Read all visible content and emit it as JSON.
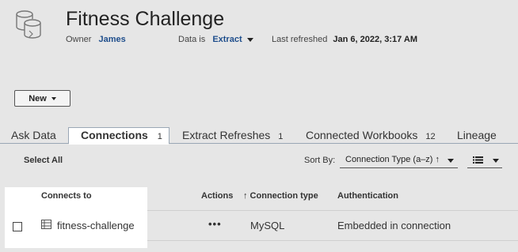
{
  "header": {
    "title": "Fitness Challenge",
    "owner_label": "Owner",
    "owner_value": "James",
    "data_label": "Data is",
    "data_value": "Extract",
    "refreshed_label": "Last refreshed",
    "refreshed_value": "Jan 6, 2022, 3:17 AM"
  },
  "toolbar": {
    "new_label": "New"
  },
  "tabs": [
    {
      "label": "Ask Data",
      "count": ""
    },
    {
      "label": "Connections",
      "count": "1"
    },
    {
      "label": "Extract Refreshes",
      "count": "1"
    },
    {
      "label": "Connected Workbooks",
      "count": "12"
    },
    {
      "label": "Lineage",
      "count": ""
    }
  ],
  "list_controls": {
    "select_all": "Select All",
    "sort_by_label": "Sort By:",
    "sort_value": "Connection Type (a–z) ↑"
  },
  "table": {
    "columns": [
      "Connects to",
      "Actions",
      "↑ Connection type",
      "Authentication"
    ],
    "rows": [
      {
        "name": "fitness-challenge",
        "actions": "•••",
        "type": "MySQL",
        "auth": "Embedded in connection"
      }
    ]
  },
  "icons": {
    "datasource": "datasource-cylinders-icon",
    "connection": "database-table-icon",
    "view": "list-view-icon"
  },
  "colors": {
    "accent": "#1f4e8c",
    "background": "#e6e6e6",
    "tab_border": "#9aa7b5"
  }
}
